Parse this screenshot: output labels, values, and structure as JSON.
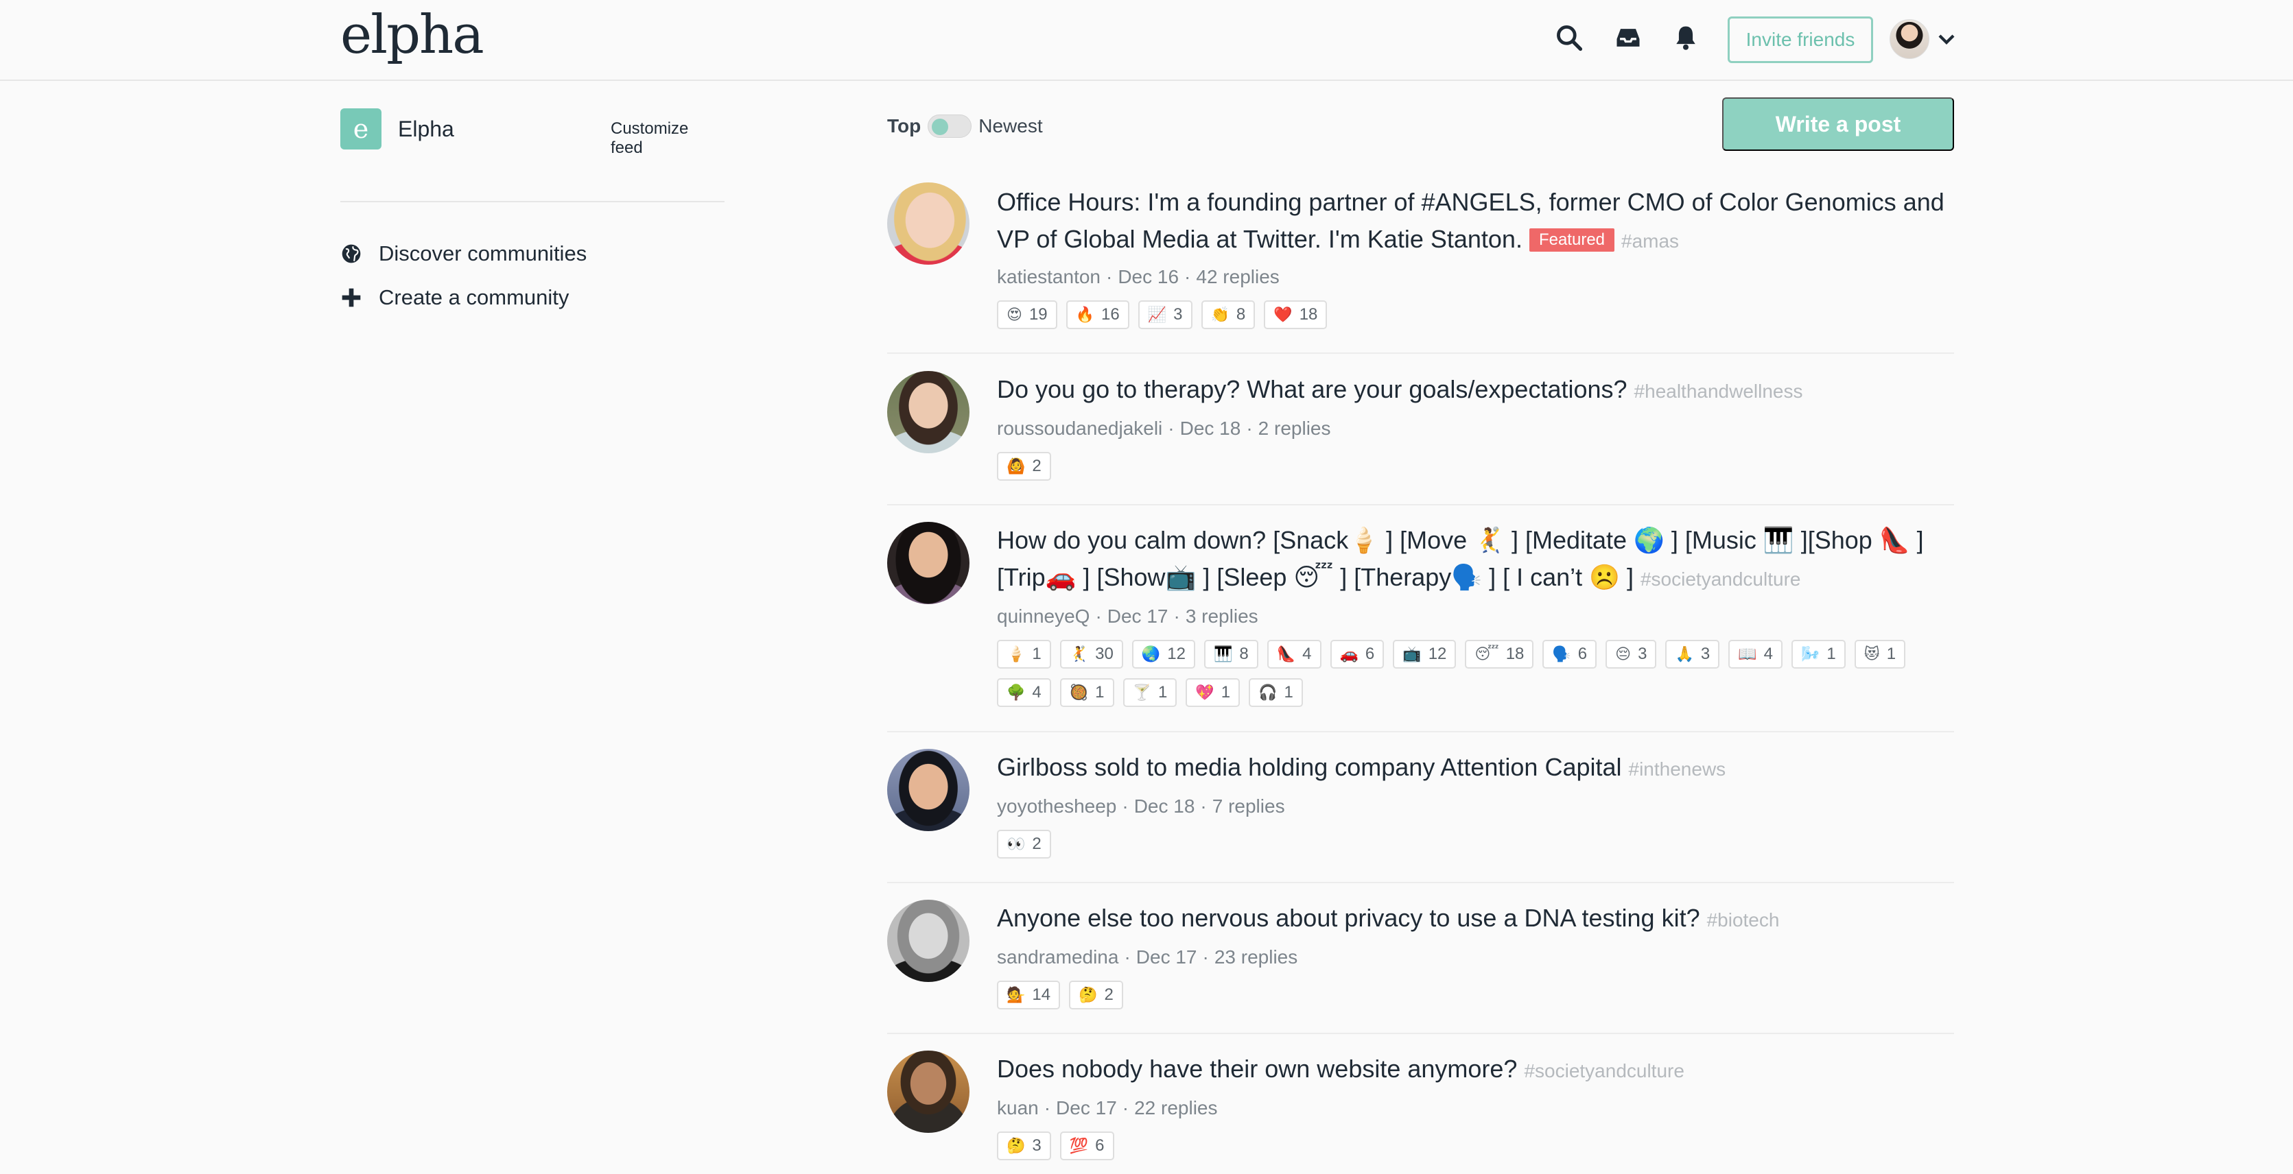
{
  "header": {
    "logo": "elpha",
    "invite_label": "Invite friends",
    "icons": [
      "search-icon",
      "inbox-icon",
      "bell-icon",
      "chevron-down-icon"
    ]
  },
  "sidebar": {
    "community_initial": "e",
    "community_name": "Elpha",
    "customize_label": "Customize feed",
    "links": [
      {
        "label": "Discover communities",
        "icon": "globe-icon"
      },
      {
        "label": "Create a community",
        "icon": "plus-icon"
      }
    ]
  },
  "feed": {
    "sort_top": "Top",
    "sort_newest": "Newest",
    "write_label": "Write a post",
    "posts": [
      {
        "title": "Office Hours: I'm a founding partner of #ANGELS, former CMO of Color Genomics and VP of Global Media at Twitter. I'm Katie Stanton.",
        "featured": "Featured",
        "hashtag": "#amas",
        "author": "katiestanton",
        "date": "Dec 16",
        "replies": "42 replies",
        "reactions": [
          {
            "emoji": "😍",
            "count": "19"
          },
          {
            "emoji": "🔥",
            "count": "16"
          },
          {
            "emoji": "📈",
            "count": "3"
          },
          {
            "emoji": "👏",
            "count": "8"
          },
          {
            "emoji": "❤️",
            "count": "18"
          }
        ]
      },
      {
        "title": "Do you go to therapy? What are your goals/expectations?",
        "hashtag": "#healthandwellness",
        "author": "roussoudanedjakeli",
        "date": "Dec 18",
        "replies": "2 replies",
        "reactions": [
          {
            "emoji": "🙆",
            "count": "2"
          }
        ]
      },
      {
        "title": "How do you calm down? [Snack🍦 ] [Move 🤾 ] [Meditate 🌍 ] [Music 🎹 ][Shop 👠 ] [Trip🚗 ] [Show📺 ] [Sleep 😴 ] [Therapy🗣️ ] [ I can’t ☹️ ]",
        "hashtag": "#societyandculture",
        "author": "quinneyeQ",
        "date": "Dec 17",
        "replies": "3 replies",
        "reactions": [
          {
            "emoji": "🍦",
            "count": "1"
          },
          {
            "emoji": "🤾",
            "count": "30"
          },
          {
            "emoji": "🌏",
            "count": "12"
          },
          {
            "emoji": "🎹",
            "count": "8"
          },
          {
            "emoji": "👠",
            "count": "4"
          },
          {
            "emoji": "🚗",
            "count": "6"
          },
          {
            "emoji": "📺",
            "count": "12"
          },
          {
            "emoji": "😴",
            "count": "18"
          },
          {
            "emoji": "🗣️",
            "count": "6"
          },
          {
            "emoji": "😔",
            "count": "3"
          },
          {
            "emoji": "🙏",
            "count": "3"
          },
          {
            "emoji": "📖",
            "count": "4"
          },
          {
            "emoji": "🌬️",
            "count": "1"
          },
          {
            "emoji": "😻",
            "count": "1"
          },
          {
            "emoji": "🌳",
            "count": "4"
          },
          {
            "emoji": "🥘",
            "count": "1"
          },
          {
            "emoji": "🍸",
            "count": "1"
          },
          {
            "emoji": "💖",
            "count": "1"
          },
          {
            "emoji": "🎧",
            "count": "1"
          }
        ]
      },
      {
        "title": "Girlboss sold to media holding company Attention Capital",
        "hashtag": "#inthenews",
        "author": "yoyothesheep",
        "date": "Dec 18",
        "replies": "7 replies",
        "reactions": [
          {
            "emoji": "👀",
            "count": "2"
          }
        ]
      },
      {
        "title": "Anyone else too nervous about privacy to use a DNA testing kit?",
        "hashtag": "#biotech",
        "author": "sandramedina",
        "date": "Dec 17",
        "replies": "23 replies",
        "reactions": [
          {
            "emoji": "💁",
            "count": "14"
          },
          {
            "emoji": "🤔",
            "count": "2"
          }
        ]
      },
      {
        "title": "Does nobody have their own website anymore?",
        "hashtag": "#societyandculture",
        "author": "kuan",
        "date": "Dec 17",
        "replies": "22 replies",
        "reactions": [
          {
            "emoji": "🤔",
            "count": "3"
          },
          {
            "emoji": "💯",
            "count": "6"
          }
        ]
      }
    ]
  },
  "colors": {
    "accent": "#8ed2c1",
    "featured": "#ef6868",
    "text": "#1f2a35",
    "muted": "#7d858c"
  }
}
